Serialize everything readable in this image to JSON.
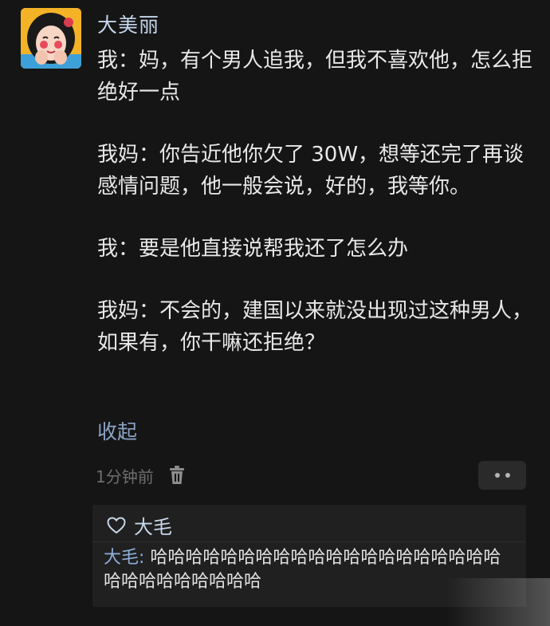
{
  "post": {
    "username": "大美丽",
    "paragraphs": [
      "我：妈，有个男人追我，但我不喜欢他，怎么拒绝好一点",
      "我妈：你告近他你欠了 30W，想等还完了再谈感情问题，他一般会说，好的，我等你。",
      "我：要是他直接说帮我还了怎么办",
      "我妈：不会的，建国以来就没出现过这种男人，如果有，你干嘛还拒绝？"
    ],
    "collapse_label": "收起",
    "time": "1分钟前"
  },
  "likes": {
    "names": "大毛"
  },
  "comment": {
    "author": "大毛:",
    "text": " 哈哈哈哈哈哈哈哈哈哈哈哈哈哈哈哈哈哈哈哈哈哈哈哈哈哈哈哈哈"
  },
  "icons": {
    "avatar": "cartoon-girl-avatar",
    "delete": "trash-icon",
    "more": "more-dots-icon",
    "like": "heart-outline-icon"
  },
  "colors": {
    "background": "#151515",
    "name_link": "#c5d5ec",
    "collapse_link": "#8aa4c6",
    "comment_box": "#202020"
  }
}
